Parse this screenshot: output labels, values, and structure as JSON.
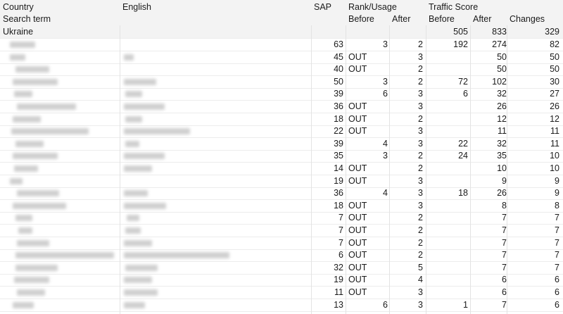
{
  "headers": {
    "country": "Country",
    "search_term": "Search term",
    "english": "English",
    "sap": "SAP",
    "rank_usage": "Rank/Usage",
    "rank_before": "Before",
    "rank_after": "After",
    "traffic_score": "Traffic Score",
    "traffic_before": "Before",
    "traffic_after": "After",
    "changes": "Changes"
  },
  "group": {
    "country": "Ukraine",
    "traffic_before": "505",
    "traffic_after": "833",
    "changes": "329"
  },
  "rows": [
    {
      "sap": "63",
      "rank_before": "3",
      "rank_after": "2",
      "traffic_before": "192",
      "traffic_after": "274",
      "changes": "82"
    },
    {
      "sap": "45",
      "rank_before": "OUT",
      "rank_after": "3",
      "traffic_before": "",
      "traffic_after": "50",
      "changes": "50"
    },
    {
      "sap": "40",
      "rank_before": "OUT",
      "rank_after": "2",
      "traffic_before": "",
      "traffic_after": "50",
      "changes": "50"
    },
    {
      "sap": "50",
      "rank_before": "3",
      "rank_after": "2",
      "traffic_before": "72",
      "traffic_after": "102",
      "changes": "30"
    },
    {
      "sap": "39",
      "rank_before": "6",
      "rank_after": "3",
      "traffic_before": "6",
      "traffic_after": "32",
      "changes": "27"
    },
    {
      "sap": "36",
      "rank_before": "OUT",
      "rank_after": "3",
      "traffic_before": "",
      "traffic_after": "26",
      "changes": "26"
    },
    {
      "sap": "18",
      "rank_before": "OUT",
      "rank_after": "2",
      "traffic_before": "",
      "traffic_after": "12",
      "changes": "12"
    },
    {
      "sap": "22",
      "rank_before": "OUT",
      "rank_after": "3",
      "traffic_before": "",
      "traffic_after": "11",
      "changes": "11"
    },
    {
      "sap": "39",
      "rank_before": "4",
      "rank_after": "3",
      "traffic_before": "22",
      "traffic_after": "32",
      "changes": "11"
    },
    {
      "sap": "35",
      "rank_before": "3",
      "rank_after": "2",
      "traffic_before": "24",
      "traffic_after": "35",
      "changes": "10"
    },
    {
      "sap": "14",
      "rank_before": "OUT",
      "rank_after": "2",
      "traffic_before": "",
      "traffic_after": "10",
      "changes": "10"
    },
    {
      "sap": "19",
      "rank_before": "OUT",
      "rank_after": "3",
      "traffic_before": "",
      "traffic_after": "9",
      "changes": "9"
    },
    {
      "sap": "36",
      "rank_before": "4",
      "rank_after": "3",
      "traffic_before": "18",
      "traffic_after": "26",
      "changes": "9"
    },
    {
      "sap": "18",
      "rank_before": "OUT",
      "rank_after": "3",
      "traffic_before": "",
      "traffic_after": "8",
      "changes": "8"
    },
    {
      "sap": "7",
      "rank_before": "OUT",
      "rank_after": "2",
      "traffic_before": "",
      "traffic_after": "7",
      "changes": "7"
    },
    {
      "sap": "7",
      "rank_before": "OUT",
      "rank_after": "2",
      "traffic_before": "",
      "traffic_after": "7",
      "changes": "7"
    },
    {
      "sap": "7",
      "rank_before": "OUT",
      "rank_after": "2",
      "traffic_before": "",
      "traffic_after": "7",
      "changes": "7"
    },
    {
      "sap": "6",
      "rank_before": "OUT",
      "rank_after": "2",
      "traffic_before": "",
      "traffic_after": "7",
      "changes": "7"
    },
    {
      "sap": "32",
      "rank_before": "OUT",
      "rank_after": "5",
      "traffic_before": "",
      "traffic_after": "7",
      "changes": "7"
    },
    {
      "sap": "19",
      "rank_before": "OUT",
      "rank_after": "4",
      "traffic_before": "",
      "traffic_after": "6",
      "changes": "6"
    },
    {
      "sap": "11",
      "rank_before": "OUT",
      "rank_after": "3",
      "traffic_before": "",
      "traffic_after": "6",
      "changes": "6"
    },
    {
      "sap": "13",
      "rank_before": "6",
      "rank_after": "3",
      "traffic_before": "1",
      "traffic_after": "7",
      "changes": "6"
    }
  ]
}
